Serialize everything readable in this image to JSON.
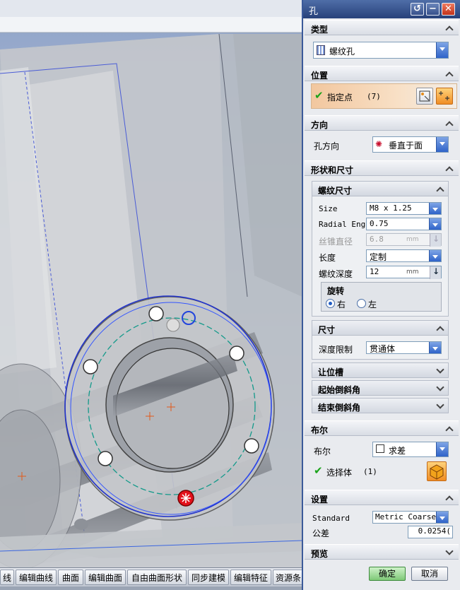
{
  "toolbar": {
    "items": [
      "线",
      "编辑曲线",
      "曲面",
      "编辑曲面",
      "自由曲面形状",
      "同步建模",
      "编辑特征",
      "资源条"
    ]
  },
  "dialog": {
    "title": "孔",
    "sections": {
      "type": {
        "label": "类型",
        "value": "螺纹孔"
      },
      "position": {
        "label": "位置",
        "specify_point": "指定点",
        "point_count": "(7)"
      },
      "direction": {
        "label": "方向",
        "field_label": "孔方向",
        "value": "垂直于面"
      },
      "shape": {
        "label": "形状和尺寸",
        "thread": {
          "label": "螺纹尺寸",
          "size_label": "Size",
          "size_value": "M8 x 1.25",
          "radial_label": "Radial Eng",
          "radial_value": "0.75",
          "tap_label": "丝锥直径",
          "tap_value": "6.8",
          "tap_unit": "mm",
          "length_label": "长度",
          "length_value": "定制",
          "depth_label": "螺纹深度",
          "depth_value": "12",
          "depth_unit": "mm",
          "rotation": {
            "label": "旋转",
            "right": "右",
            "left": "左"
          }
        },
        "dimensions": {
          "label": "尺寸",
          "depth_limit_label": "深度限制",
          "depth_limit_value": "贯通体"
        },
        "relief": "让位槽",
        "start_chamfer": "起始倒斜角",
        "end_chamfer": "结束倒斜角"
      },
      "boolean": {
        "label": "布尔",
        "field_label": "布尔",
        "value": "求差",
        "select_body": "选择体",
        "body_count": "(1)"
      },
      "settings": {
        "label": "设置",
        "standard_label": "Standard",
        "standard_value": "Metric Coarse",
        "tolerance_label": "公差",
        "tolerance_value": "0.0254("
      },
      "preview": {
        "label": "预览"
      }
    },
    "ok": "确定",
    "cancel": "取消"
  },
  "colors": {
    "title_bar": "#27417a",
    "accent": "#2f63c9",
    "ok_green": "#7fc978",
    "highlight_orange": "#f2c79f"
  }
}
